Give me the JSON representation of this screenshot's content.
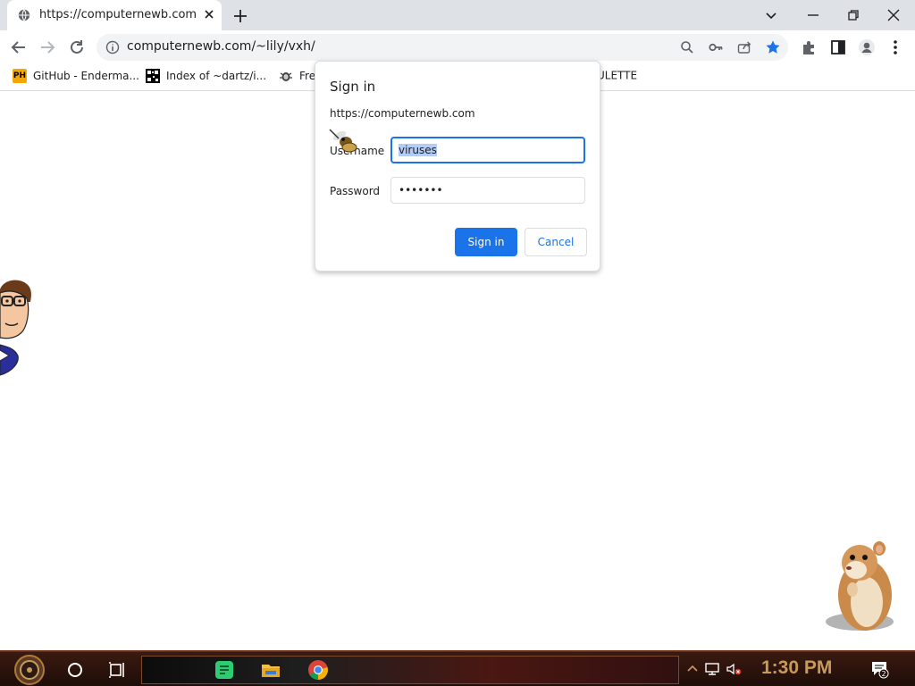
{
  "browser": {
    "tab": {
      "title": "https://computernewb.com/~lily/vxh/"
    },
    "address": {
      "url": "computernewb.com/~lily/vxh/"
    },
    "bookmarks": [
      {
        "label": "GitHub - Enderma...",
        "icon": "ph-icon"
      },
      {
        "label": "Index of ~dartz/i...",
        "icon": "qr-icon"
      },
      {
        "label": "Fre",
        "icon": "bug-icon"
      },
      {
        "label": "ULETTE",
        "icon": ""
      }
    ]
  },
  "dialog": {
    "title": "Sign in",
    "origin": "https://computernewb.com",
    "username_label": "Username",
    "username_value": "viruses",
    "password_label": "Password",
    "password_value": "•••••••",
    "signin_label": "Sign in",
    "cancel_label": "Cancel"
  },
  "taskbar": {
    "clock": "1:30 PM",
    "notification_count": "2"
  },
  "colors": {
    "accent": "#1a73e8",
    "tabstrip": "#dee1e6",
    "clock": "#c89a5a"
  }
}
